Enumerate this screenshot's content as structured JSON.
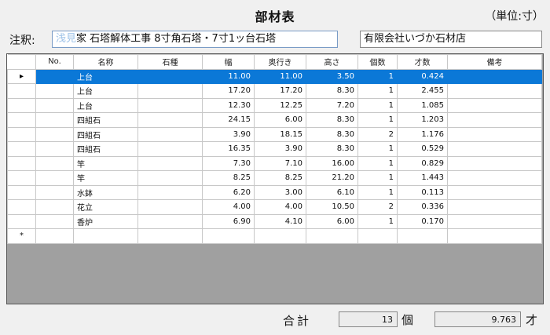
{
  "title": "部材表",
  "unit_label": "（単位:寸）",
  "note": {
    "label": "注釈:",
    "value_selected": "浅見",
    "value_rest": "家 石塔解体工事  8寸角石塔・7寸1ッ台石塔"
  },
  "company": "有限会社いづか石材店",
  "table": {
    "headers": [
      "No.",
      "名称",
      "石種",
      "幅",
      "奥行き",
      "高さ",
      "個数",
      "才数",
      "備考"
    ],
    "current_marker": "▸",
    "new_row_marker": "*",
    "rows": [
      {
        "no": "",
        "name": "上台",
        "stone": "",
        "width": "11.00",
        "depth": "11.00",
        "height": "3.50",
        "count": "1",
        "sai": "0.424",
        "note": ""
      },
      {
        "no": "",
        "name": "上台",
        "stone": "",
        "width": "17.20",
        "depth": "17.20",
        "height": "8.30",
        "count": "1",
        "sai": "2.455",
        "note": ""
      },
      {
        "no": "",
        "name": "上台",
        "stone": "",
        "width": "12.30",
        "depth": "12.25",
        "height": "7.20",
        "count": "1",
        "sai": "1.085",
        "note": ""
      },
      {
        "no": "",
        "name": "四組石",
        "stone": "",
        "width": "24.15",
        "depth": "6.00",
        "height": "8.30",
        "count": "1",
        "sai": "1.203",
        "note": ""
      },
      {
        "no": "",
        "name": "四組石",
        "stone": "",
        "width": "3.90",
        "depth": "18.15",
        "height": "8.30",
        "count": "2",
        "sai": "1.176",
        "note": ""
      },
      {
        "no": "",
        "name": "四組石",
        "stone": "",
        "width": "16.35",
        "depth": "3.90",
        "height": "8.30",
        "count": "1",
        "sai": "0.529",
        "note": ""
      },
      {
        "no": "",
        "name": "竿",
        "stone": "",
        "width": "7.30",
        "depth": "7.10",
        "height": "16.00",
        "count": "1",
        "sai": "0.829",
        "note": ""
      },
      {
        "no": "",
        "name": "竿",
        "stone": "",
        "width": "8.25",
        "depth": "8.25",
        "height": "21.20",
        "count": "1",
        "sai": "1.443",
        "note": ""
      },
      {
        "no": "",
        "name": "水鉢",
        "stone": "",
        "width": "6.20",
        "depth": "3.00",
        "height": "6.10",
        "count": "1",
        "sai": "0.113",
        "note": ""
      },
      {
        "no": "",
        "name": "花立",
        "stone": "",
        "width": "4.00",
        "depth": "4.00",
        "height": "10.50",
        "count": "2",
        "sai": "0.336",
        "note": ""
      },
      {
        "no": "",
        "name": "香炉",
        "stone": "",
        "width": "6.90",
        "depth": "4.10",
        "height": "6.00",
        "count": "1",
        "sai": "0.170",
        "note": ""
      }
    ]
  },
  "totals": {
    "label": "合計",
    "count": "13",
    "count_unit": "個",
    "sai": "9.763",
    "sai_unit": "才"
  },
  "colors": {
    "selection": "#0b78d7",
    "empty_area": "#a0a0a0"
  }
}
